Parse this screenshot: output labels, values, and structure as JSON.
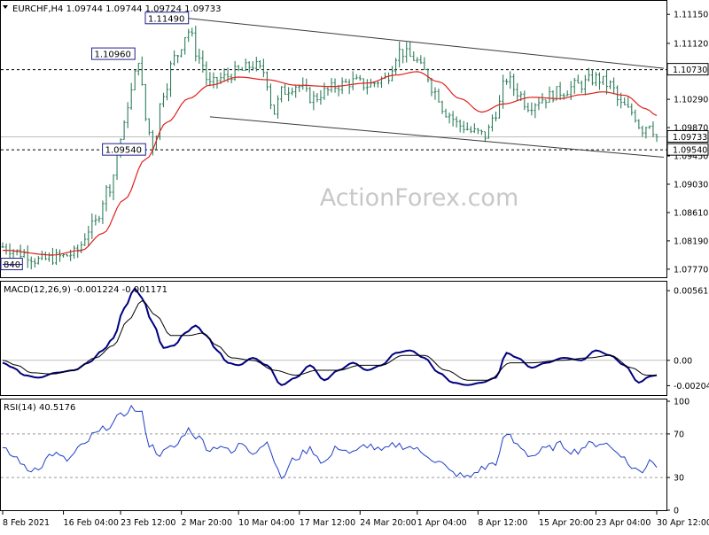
{
  "chart_data": [
    {
      "type": "candlestick",
      "symbol_header": "EURCHF,H4  1.09744 1.09744 1.09724 1.09733",
      "watermark": "ActionForex.com",
      "price_ticks": [
        "1.11150",
        "1.11120",
        "1.10730",
        "1.10290",
        "1.09870",
        "1.09450",
        "1.09030",
        "1.08610",
        "1.08190",
        "1.07770"
      ],
      "tick_values": [
        1.1155,
        1.1112,
        1.1073,
        1.1029,
        1.0987,
        1.0945,
        1.0903,
        1.0861,
        1.0819,
        1.0777
      ],
      "ylim": [
        1.0765,
        1.1175
      ],
      "current_price": {
        "label": "1.09733",
        "value": 1.09733
      },
      "horizontal_levels": [
        {
          "label": "1.10730",
          "value": 1.1073
        },
        {
          "label": "1.09540",
          "value": 1.0954
        }
      ],
      "annotations": [
        {
          "label": "1.11490",
          "value": 1.1149,
          "x_index": 52
        },
        {
          "label": "1.10960",
          "value": 1.1096,
          "x_index": 37
        },
        {
          "label": "1.09540",
          "value": 1.0954,
          "x_index": 40
        },
        {
          "label": "840",
          "value": 1.0784,
          "x_index": 0
        }
      ],
      "channel_lines": [
        {
          "from": {
            "x_index": 52,
            "value": 1.1149
          },
          "to": {
            "x_index": 185,
            "value": 1.1075
          }
        },
        {
          "from": {
            "x_index": 58,
            "value": 1.1003
          },
          "to": {
            "x_index": 185,
            "value": 1.0943
          }
        }
      ],
      "x_labels": [
        "8 Feb 2021",
        "16 Feb 04:00",
        "23 Feb 12:00",
        "2 Mar 20:00",
        "10 Mar 04:00",
        "17 Mar 12:00",
        "24 Mar 20:00",
        "1 Apr 04:00",
        "8 Apr 12:00",
        "15 Apr 20:00",
        "23 Apr 04:00",
        "30 Apr 12:00"
      ],
      "x_label_indices": [
        0,
        17,
        33,
        50,
        66,
        83,
        100,
        116,
        133,
        150,
        166,
        183
      ],
      "bar_count": 184,
      "price_keypoints": [
        [
          0,
          1.081
        ],
        [
          6,
          1.08
        ],
        [
          10,
          1.079
        ],
        [
          16,
          1.0795
        ],
        [
          20,
          1.08
        ],
        [
          25,
          1.084
        ],
        [
          30,
          1.09
        ],
        [
          33,
          1.097
        ],
        [
          36,
          1.104
        ],
        [
          38,
          1.109
        ],
        [
          40,
          1.1
        ],
        [
          42,
          1.096
        ],
        [
          45,
          1.104
        ],
        [
          48,
          1.109
        ],
        [
          52,
          1.113
        ],
        [
          55,
          1.109
        ],
        [
          58,
          1.105
        ],
        [
          61,
          1.106
        ],
        [
          66,
          1.107
        ],
        [
          70,
          1.108
        ],
        [
          73,
          1.107
        ],
        [
          76,
          1.101
        ],
        [
          78,
          1.104
        ],
        [
          82,
          1.105
        ],
        [
          87,
          1.103
        ],
        [
          90,
          1.104
        ],
        [
          94,
          1.105
        ],
        [
          98,
          1.1055
        ],
        [
          102,
          1.105
        ],
        [
          107,
          1.106
        ],
        [
          111,
          1.11
        ],
        [
          115,
          1.109
        ],
        [
          118,
          1.107
        ],
        [
          121,
          1.104
        ],
        [
          124,
          1.101
        ],
        [
          128,
          1.099
        ],
        [
          132,
          1.098
        ],
        [
          135,
          1.0975
        ],
        [
          138,
          1.101
        ],
        [
          141,
          1.106
        ],
        [
          144,
          1.104
        ],
        [
          147,
          1.102
        ],
        [
          151,
          1.103
        ],
        [
          156,
          1.104
        ],
        [
          161,
          1.105
        ],
        [
          166,
          1.106
        ],
        [
          170,
          1.105
        ],
        [
          173,
          1.102
        ],
        [
          176,
          1.101
        ],
        [
          179,
          1.0985
        ],
        [
          181,
          1.0995
        ],
        [
          183,
          1.0973
        ]
      ],
      "ma_keypoints": [
        [
          0,
          1.0805
        ],
        [
          14,
          1.0798
        ],
        [
          22,
          1.0805
        ],
        [
          28,
          1.083
        ],
        [
          34,
          1.088
        ],
        [
          40,
          1.094
        ],
        [
          46,
          1.0995
        ],
        [
          52,
          1.103
        ],
        [
          58,
          1.105
        ],
        [
          66,
          1.1062
        ],
        [
          74,
          1.1058
        ],
        [
          82,
          1.105
        ],
        [
          92,
          1.1048
        ],
        [
          102,
          1.1053
        ],
        [
          110,
          1.1065
        ],
        [
          116,
          1.107
        ],
        [
          122,
          1.1055
        ],
        [
          128,
          1.103
        ],
        [
          134,
          1.101
        ],
        [
          140,
          1.1022
        ],
        [
          148,
          1.1032
        ],
        [
          156,
          1.103
        ],
        [
          162,
          1.1036
        ],
        [
          168,
          1.104
        ],
        [
          174,
          1.1035
        ],
        [
          180,
          1.1015
        ],
        [
          183,
          1.1005
        ]
      ]
    },
    {
      "type": "line",
      "header": "MACD(12,26,9) -0.001224 -0.001171",
      "y_ticks": [
        "0.005618",
        "0.00",
        "-0.002046"
      ],
      "tick_values": [
        0.005618,
        0.0,
        -0.002046
      ],
      "ylim": [
        -0.0028,
        0.0062
      ],
      "series": [
        {
          "color": "#000080",
          "keypoints": [
            [
              0,
              -0.0002
            ],
            [
              3,
              -0.0006
            ],
            [
              6,
              -0.0012
            ],
            [
              10,
              -0.0014
            ],
            [
              15,
              -0.001
            ],
            [
              20,
              -0.0008
            ],
            [
              24,
              -0.0002
            ],
            [
              28,
              0.0008
            ],
            [
              31,
              0.0018
            ],
            [
              34,
              0.0042
            ],
            [
              37,
              0.0058
            ],
            [
              39,
              0.005
            ],
            [
              42,
              0.003
            ],
            [
              45,
              0.001
            ],
            [
              48,
              0.0012
            ],
            [
              51,
              0.0022
            ],
            [
              54,
              0.0028
            ],
            [
              57,
              0.002
            ],
            [
              60,
              0.0008
            ],
            [
              63,
              -0.0002
            ],
            [
              66,
              -0.0004
            ],
            [
              70,
              0.0002
            ],
            [
              74,
              -0.0004
            ],
            [
              78,
              -0.002
            ],
            [
              82,
              -0.0014
            ],
            [
              86,
              -0.0004
            ],
            [
              90,
              -0.0016
            ],
            [
              94,
              -0.0008
            ],
            [
              98,
              -0.0002
            ],
            [
              102,
              -0.0008
            ],
            [
              106,
              -0.0004
            ],
            [
              110,
              0.0006
            ],
            [
              114,
              0.0008
            ],
            [
              118,
              0.0002
            ],
            [
              122,
              -0.001
            ],
            [
              126,
              -0.0018
            ],
            [
              130,
              -0.002
            ],
            [
              134,
              -0.0018
            ],
            [
              138,
              -0.0014
            ],
            [
              141,
              0.0006
            ],
            [
              144,
              0.0002
            ],
            [
              148,
              -0.0006
            ],
            [
              152,
              -0.0002
            ],
            [
              157,
              0.0002
            ],
            [
              162,
              0.0
            ],
            [
              166,
              0.0008
            ],
            [
              170,
              0.0004
            ],
            [
              174,
              -0.0004
            ],
            [
              178,
              -0.0018
            ],
            [
              181,
              -0.0013
            ],
            [
              183,
              -0.0012
            ]
          ]
        },
        {
          "color": "#000000",
          "keypoints": [
            [
              0,
              0.0
            ],
            [
              4,
              -0.0004
            ],
            [
              8,
              -0.001
            ],
            [
              14,
              -0.0011
            ],
            [
              20,
              -0.0008
            ],
            [
              26,
              0.0002
            ],
            [
              31,
              0.0012
            ],
            [
              35,
              0.0032
            ],
            [
              39,
              0.0048
            ],
            [
              43,
              0.0036
            ],
            [
              47,
              0.002
            ],
            [
              52,
              0.002
            ],
            [
              56,
              0.0022
            ],
            [
              60,
              0.0012
            ],
            [
              64,
              0.0002
            ],
            [
              70,
              0.0
            ],
            [
              76,
              -0.0008
            ],
            [
              82,
              -0.0012
            ],
            [
              88,
              -0.0008
            ],
            [
              94,
              -0.0008
            ],
            [
              100,
              -0.0004
            ],
            [
              106,
              -0.0004
            ],
            [
              112,
              0.0004
            ],
            [
              118,
              0.0004
            ],
            [
              124,
              -0.0008
            ],
            [
              130,
              -0.0016
            ],
            [
              136,
              -0.0016
            ],
            [
              142,
              -0.0002
            ],
            [
              148,
              -0.0002
            ],
            [
              156,
              0.0
            ],
            [
              164,
              0.0002
            ],
            [
              170,
              0.0004
            ],
            [
              176,
              -0.0006
            ],
            [
              180,
              -0.0012
            ],
            [
              183,
              -0.0012
            ]
          ]
        }
      ]
    },
    {
      "type": "line",
      "header": "RSI(14) 40.5176",
      "y_ticks": [
        "100",
        "70",
        "30",
        "0"
      ],
      "tick_values": [
        100,
        70,
        30,
        0
      ],
      "ylim": [
        0,
        100
      ],
      "levels": [
        70,
        30
      ],
      "series": [
        {
          "color": "#1f3fc7",
          "keypoints": [
            [
              0,
              55
            ],
            [
              4,
              48
            ],
            [
              7,
              36
            ],
            [
              10,
              40
            ],
            [
              14,
              52
            ],
            [
              18,
              46
            ],
            [
              22,
              58
            ],
            [
              26,
              70
            ],
            [
              30,
              78
            ],
            [
              33,
              86
            ],
            [
              36,
              94
            ],
            [
              39,
              88
            ],
            [
              41,
              60
            ],
            [
              44,
              52
            ],
            [
              48,
              58
            ],
            [
              52,
              74
            ],
            [
              55,
              66
            ],
            [
              58,
              56
            ],
            [
              61,
              60
            ],
            [
              64,
              52
            ],
            [
              67,
              62
            ],
            [
              70,
              54
            ],
            [
              74,
              62
            ],
            [
              78,
              30
            ],
            [
              82,
              48
            ],
            [
              86,
              56
            ],
            [
              90,
              44
            ],
            [
              94,
              58
            ],
            [
              98,
              52
            ],
            [
              102,
              60
            ],
            [
              106,
              54
            ],
            [
              110,
              60
            ],
            [
              114,
              58
            ],
            [
              118,
              52
            ],
            [
              122,
              44
            ],
            [
              126,
              34
            ],
            [
              130,
              30
            ],
            [
              134,
              38
            ],
            [
              138,
              44
            ],
            [
              141,
              70
            ],
            [
              144,
              60
            ],
            [
              148,
              50
            ],
            [
              152,
              56
            ],
            [
              156,
              60
            ],
            [
              160,
              54
            ],
            [
              164,
              60
            ],
            [
              168,
              62
            ],
            [
              172,
              54
            ],
            [
              176,
              40
            ],
            [
              179,
              34
            ],
            [
              181,
              48
            ],
            [
              183,
              41
            ]
          ]
        }
      ]
    }
  ]
}
